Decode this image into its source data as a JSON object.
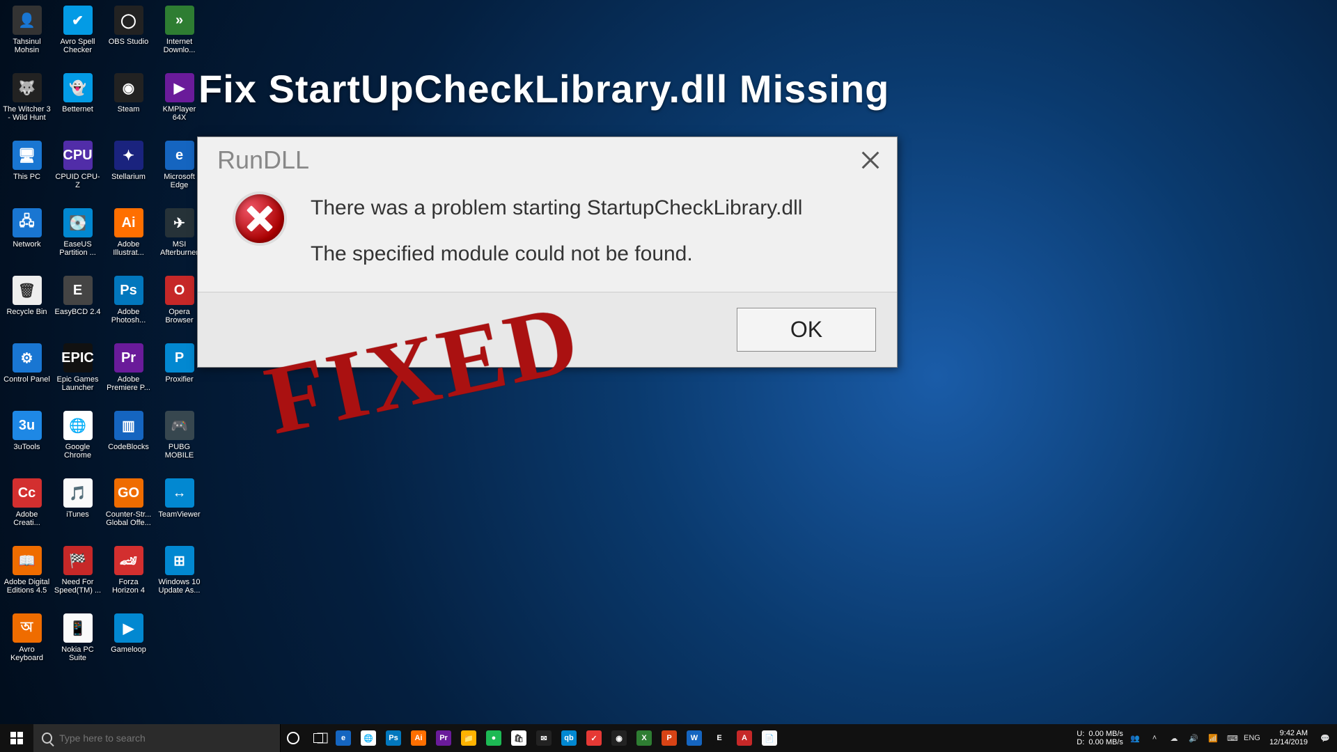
{
  "headline": "Fix StartUpCheckLibrary.dll Missing",
  "stamp": "FIXED",
  "dialog": {
    "title": "RunDLL",
    "line1": "There was a problem starting StartupCheckLibrary.dll",
    "line2": "The specified module could not be found.",
    "ok": "OK"
  },
  "desktop": {
    "cols": [
      [
        {
          "label": "Tahsinul Mohsin",
          "bg": "#333",
          "glyph": "👤"
        },
        {
          "label": "The Witcher 3 - Wild Hunt",
          "bg": "#222",
          "glyph": "🐺"
        },
        {
          "label": "This PC",
          "bg": "#1976d2",
          "glyph": "🖥"
        },
        {
          "label": "Network",
          "bg": "#1976d2",
          "glyph": "🖧"
        },
        {
          "label": "Recycle Bin",
          "bg": "#eee",
          "glyph": "🗑"
        },
        {
          "label": "Control Panel",
          "bg": "#1976d2",
          "glyph": "⚙"
        },
        {
          "label": "3uTools",
          "bg": "#1e88e5",
          "glyph": "3u"
        },
        {
          "label": "Adobe Creati...",
          "bg": "#d32f2f",
          "glyph": "Cc"
        },
        {
          "label": "Adobe Digital Editions 4.5",
          "bg": "#ef6c00",
          "glyph": "📖"
        },
        {
          "label": "Avro Keyboard",
          "bg": "#ef6c00",
          "glyph": "অ"
        }
      ],
      [
        {
          "label": "Avro Spell Checker",
          "bg": "#039be5",
          "glyph": "✔"
        },
        {
          "label": "Betternet",
          "bg": "#039be5",
          "glyph": "👻"
        },
        {
          "label": "CPUID CPU-Z",
          "bg": "#512da8",
          "glyph": "CPU"
        },
        {
          "label": "EaseUS Partition ...",
          "bg": "#0288d1",
          "glyph": "💽"
        },
        {
          "label": "EasyBCD 2.4",
          "bg": "#444",
          "glyph": "E"
        },
        {
          "label": "Epic Games Launcher",
          "bg": "#111",
          "glyph": "EPIC"
        },
        {
          "label": "Google Chrome",
          "bg": "#fff",
          "glyph": "🌐"
        },
        {
          "label": "iTunes",
          "bg": "#fafafa",
          "glyph": "🎵"
        },
        {
          "label": "Need For Speed(TM) ...",
          "bg": "#c62828",
          "glyph": "🏁"
        },
        {
          "label": "Nokia PC Suite",
          "bg": "#fafafa",
          "glyph": "📱"
        }
      ],
      [
        {
          "label": "OBS Studio",
          "bg": "#222",
          "glyph": "◯"
        },
        {
          "label": "Steam",
          "bg": "#222",
          "glyph": "◉"
        },
        {
          "label": "Stellarium",
          "bg": "#1a237e",
          "glyph": "✦"
        },
        {
          "label": "Adobe Illustrat...",
          "bg": "#ff6f00",
          "glyph": "Ai"
        },
        {
          "label": "Adobe Photosh...",
          "bg": "#0277bd",
          "glyph": "Ps"
        },
        {
          "label": "Adobe Premiere P...",
          "bg": "#6a1b9a",
          "glyph": "Pr"
        },
        {
          "label": "CodeBlocks",
          "bg": "#1565c0",
          "glyph": "▥"
        },
        {
          "label": "Counter-Str... Global Offe...",
          "bg": "#ef6c00",
          "glyph": "GO"
        },
        {
          "label": "Forza Horizon 4",
          "bg": "#d32f2f",
          "glyph": "🏎"
        },
        {
          "label": "Gameloop",
          "bg": "#0288d1",
          "glyph": "▶"
        }
      ],
      [
        {
          "label": "Internet Downlo...",
          "bg": "#2e7d32",
          "glyph": "»"
        },
        {
          "label": "KMPlayer 64X",
          "bg": "#6a1b9a",
          "glyph": "▶"
        },
        {
          "label": "Microsoft Edge",
          "bg": "#1565c0",
          "glyph": "e"
        },
        {
          "label": "MSI Afterburner",
          "bg": "#263238",
          "glyph": "✈"
        },
        {
          "label": "Opera Browser",
          "bg": "#c62828",
          "glyph": "O"
        },
        {
          "label": "Proxifier",
          "bg": "#0288d1",
          "glyph": "P"
        },
        {
          "label": "PUBG MOBILE",
          "bg": "#37474f",
          "glyph": "🎮"
        },
        {
          "label": "TeamViewer",
          "bg": "#0288d1",
          "glyph": "↔"
        },
        {
          "label": "Windows 10 Update As...",
          "bg": "#0288d1",
          "glyph": "⊞"
        }
      ]
    ]
  },
  "search": {
    "placeholder": "Type here to search"
  },
  "taskbar_apps": [
    {
      "name": "cortana",
      "glyph": "◯",
      "bg": "transparent"
    },
    {
      "name": "task-view",
      "glyph": "▢",
      "bg": "transparent"
    },
    {
      "name": "edge",
      "glyph": "e",
      "bg": "#1565c0"
    },
    {
      "name": "chrome",
      "glyph": "🌐",
      "bg": "#fff"
    },
    {
      "name": "photoshop",
      "glyph": "Ps",
      "bg": "#0277bd"
    },
    {
      "name": "illustrator",
      "glyph": "Ai",
      "bg": "#ff6f00"
    },
    {
      "name": "premiere",
      "glyph": "Pr",
      "bg": "#6a1b9a"
    },
    {
      "name": "explorer",
      "glyph": "📁",
      "bg": "#ffb300"
    },
    {
      "name": "spotify",
      "glyph": "●",
      "bg": "#1db954"
    },
    {
      "name": "store",
      "glyph": "🛍",
      "bg": "#fff"
    },
    {
      "name": "mail",
      "glyph": "✉",
      "bg": "#222"
    },
    {
      "name": "qbittorrent",
      "glyph": "qb",
      "bg": "#0288d1"
    },
    {
      "name": "todoist",
      "glyph": "✓",
      "bg": "#e53935"
    },
    {
      "name": "steam",
      "glyph": "◉",
      "bg": "#222"
    },
    {
      "name": "excel",
      "glyph": "X",
      "bg": "#2e7d32"
    },
    {
      "name": "powerpoint",
      "glyph": "P",
      "bg": "#d84315"
    },
    {
      "name": "word",
      "glyph": "W",
      "bg": "#1565c0"
    },
    {
      "name": "epic",
      "glyph": "E",
      "bg": "#111"
    },
    {
      "name": "access",
      "glyph": "A",
      "bg": "#c62828"
    },
    {
      "name": "notepad",
      "glyph": "📄",
      "bg": "#fafafa"
    }
  ],
  "tray": {
    "net_up_label": "U:",
    "net_up": "0.00 MB/s",
    "net_dn_label": "D:",
    "net_dn": "0.00 MB/s",
    "lang": "ENG",
    "time": "9:42 AM",
    "date": "12/14/2019"
  }
}
